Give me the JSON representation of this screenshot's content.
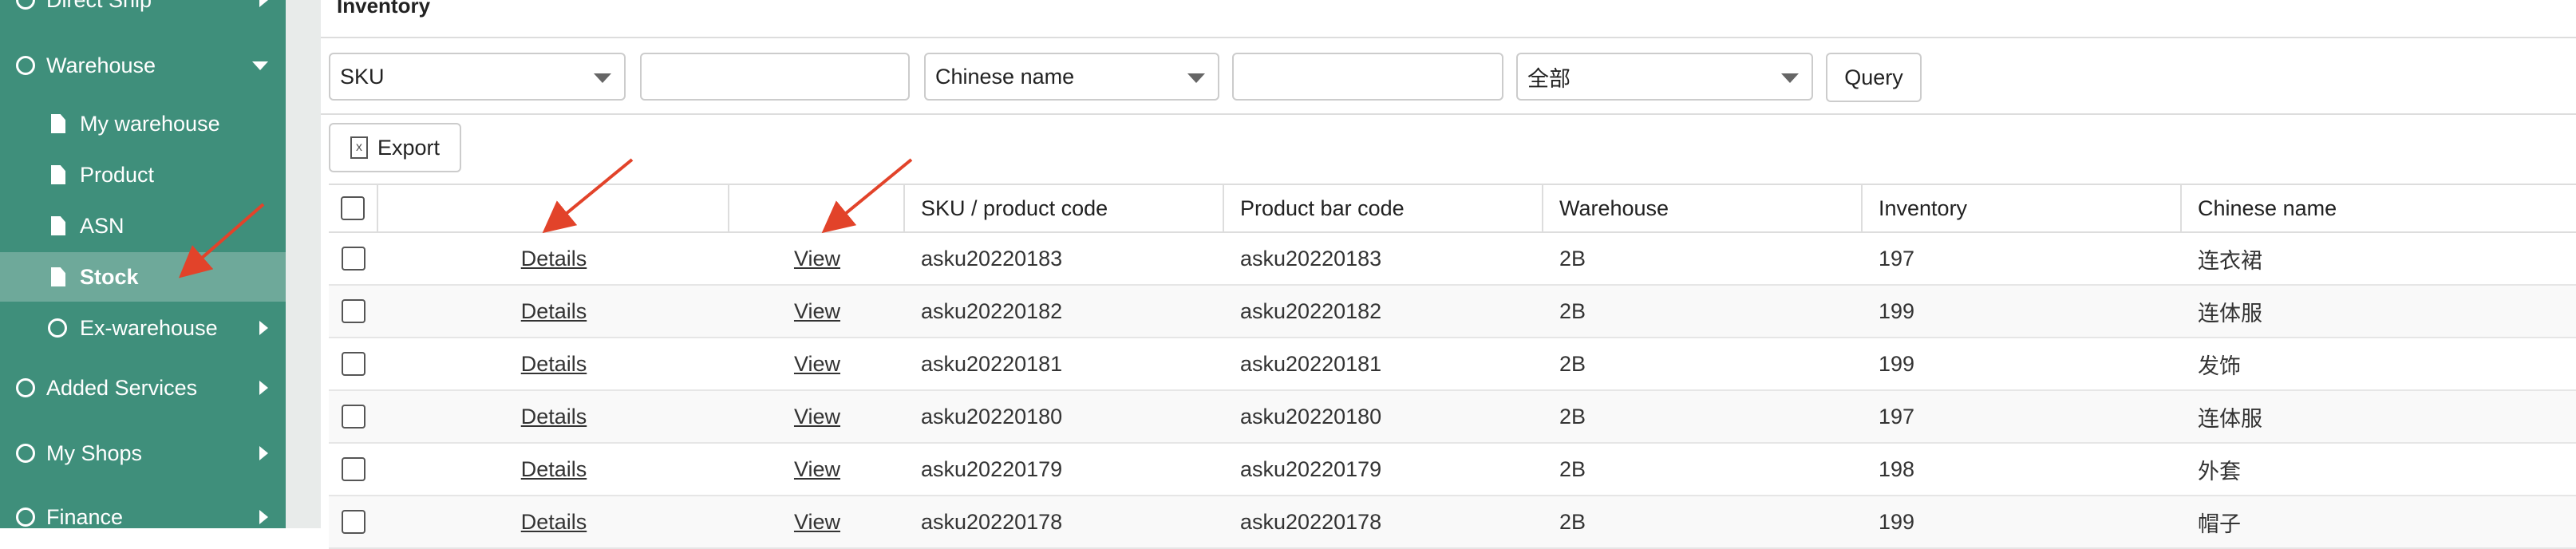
{
  "sidebar": {
    "items": [
      {
        "label": "Direct Ship"
      },
      {
        "label": "Warehouse"
      },
      {
        "label": "My warehouse"
      },
      {
        "label": "Product"
      },
      {
        "label": "ASN"
      },
      {
        "label": "Stock"
      },
      {
        "label": "Ex-warehouse"
      },
      {
        "label": "Added Services"
      },
      {
        "label": "My Shops"
      },
      {
        "label": "Finance"
      }
    ]
  },
  "main": {
    "title": "Inventory",
    "filters": {
      "select1": "SKU",
      "select2": "Chinese name",
      "select3": "全部",
      "query_label": "Query"
    },
    "export_label": "Export",
    "export_icon_glyph": "x",
    "table": {
      "headers": [
        "",
        "",
        "SKU / product code",
        "Product bar code",
        "Warehouse",
        "Inventory",
        "Chinese name"
      ],
      "rows": [
        {
          "details": "Details",
          "view": "View",
          "sku": "asku20220183",
          "barcode": "asku20220183",
          "warehouse": "2B",
          "inventory": "197",
          "name": "连衣裙"
        },
        {
          "details": "Details",
          "view": "View",
          "sku": "asku20220182",
          "barcode": "asku20220182",
          "warehouse": "2B",
          "inventory": "199",
          "name": "连体服"
        },
        {
          "details": "Details",
          "view": "View",
          "sku": "asku20220181",
          "barcode": "asku20220181",
          "warehouse": "2B",
          "inventory": "199",
          "name": "发饰"
        },
        {
          "details": "Details",
          "view": "View",
          "sku": "asku20220180",
          "barcode": "asku20220180",
          "warehouse": "2B",
          "inventory": "197",
          "name": "连体服"
        },
        {
          "details": "Details",
          "view": "View",
          "sku": "asku20220179",
          "barcode": "asku20220179",
          "warehouse": "2B",
          "inventory": "198",
          "name": "外套"
        },
        {
          "details": "Details",
          "view": "View",
          "sku": "asku20220178",
          "barcode": "asku20220178",
          "warehouse": "2B",
          "inventory": "199",
          "name": "帽子"
        }
      ]
    }
  },
  "colors": {
    "sidebar": "#3f8f7b",
    "active": "#6ea99a",
    "annotation": "#e2432a"
  }
}
